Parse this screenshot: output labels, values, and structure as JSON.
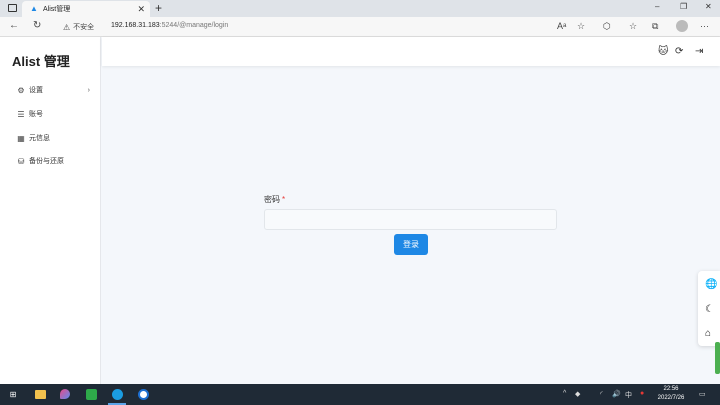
{
  "browser": {
    "tab_title": "Alist管理",
    "tab_close": "✕",
    "new_tab": "+",
    "win_minimize": "–",
    "win_restore": "❐",
    "win_close": "✕",
    "insecure_label": "不安全",
    "url_host": "192.168.31.183",
    "url_rest": ":5244/@manage/login",
    "icons": {
      "back": "←",
      "reload": "↻",
      "read_aloud": "Aᵃ",
      "favorite_add": "☆",
      "extensions": "⬡",
      "favorites": "☆",
      "collections": "⧉",
      "more": "···"
    }
  },
  "app": {
    "brand": "Alist 管理",
    "sidebar": {
      "items": [
        {
          "label": "设置",
          "icon": "gear-icon",
          "glyph": "⚙",
          "has_chevron": true,
          "chevron": "›"
        },
        {
          "label": "账号",
          "icon": "list-icon",
          "glyph": "☰"
        },
        {
          "label": "元信息",
          "icon": "meta-icon",
          "glyph": "▦"
        },
        {
          "label": "备份与还原",
          "icon": "database-icon",
          "glyph": "⛁"
        }
      ]
    },
    "topbar_icons": {
      "github": "🐱",
      "refresh": "⟳",
      "logout": "⇥"
    },
    "login": {
      "password_label": "密码",
      "required_mark": "*",
      "password_value": "",
      "login_button": "登录"
    },
    "float_icons": {
      "language": "🌐",
      "theme": "☾",
      "home": "⌂"
    }
  },
  "taskbar": {
    "start": "⊞",
    "tray": {
      "chevron": "^",
      "ime": "中",
      "volume": "🔊"
    },
    "time": "22:56",
    "date": "2022/7/26"
  },
  "colors": {
    "accent": "#1e88e5",
    "required": "#e53935",
    "taskbar": "#1f2a36"
  }
}
